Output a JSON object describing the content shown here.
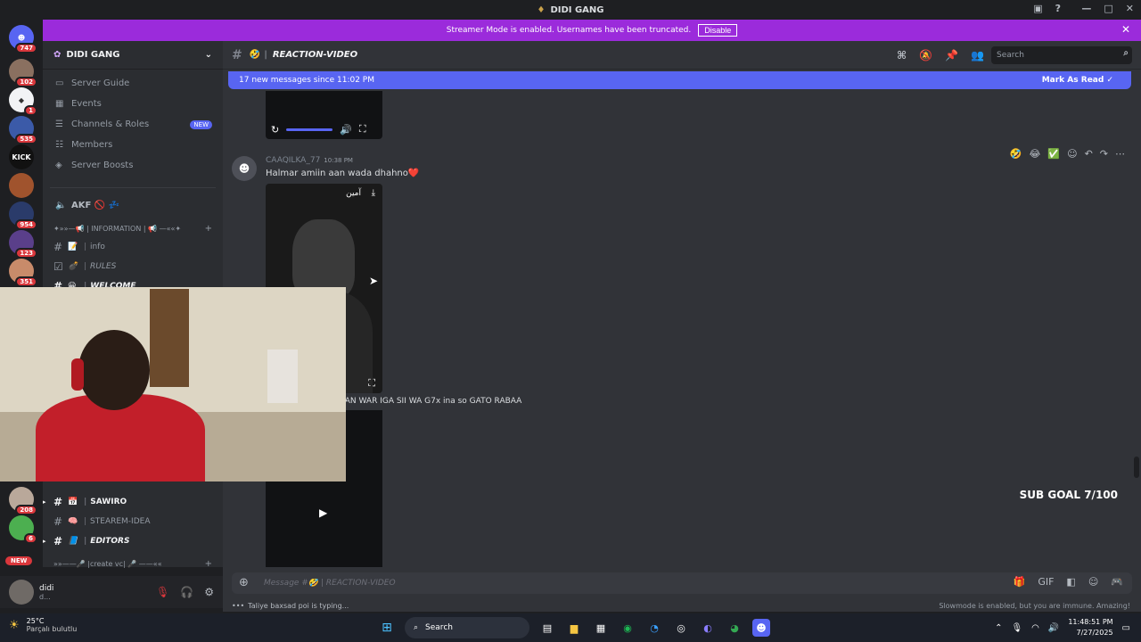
{
  "window": {
    "title": "DIDI GANG"
  },
  "banner": {
    "text": "Streamer Mode is enabled. Usernames have been truncated.",
    "disable_label": "Disable"
  },
  "server_rail": {
    "badges": [
      "747",
      "102",
      "1",
      "535",
      "954",
      "123",
      "351",
      "208",
      "6"
    ],
    "kick_label": "KICK",
    "new_label": "NEW"
  },
  "sidebar": {
    "server_name": "DIDI GANG",
    "nav": [
      {
        "label": "Server Guide",
        "icon": "book-icon"
      },
      {
        "label": "Events",
        "icon": "calendar-icon"
      },
      {
        "label": "Channels & Roles",
        "icon": "list-icon",
        "tag": "NEW"
      },
      {
        "label": "Members",
        "icon": "members-icon"
      },
      {
        "label": "Server Boosts",
        "icon": "boost-icon"
      }
    ],
    "voice_channel": "AKF 🚫 💤",
    "category_info": "✦»»—📢 | INFORMATION | 📢 —««✦",
    "channels": [
      {
        "emoji": "📝",
        "name": "info"
      },
      {
        "emoji": "💣",
        "name": "RULES"
      },
      {
        "emoji": "😀",
        "name": "WELCOME"
      }
    ],
    "channels_lower": [
      {
        "emoji": "📅",
        "name": "SAWIRO"
      },
      {
        "emoji": "🧠",
        "name": "STEAREM-IDEA"
      },
      {
        "emoji": "📘",
        "name": "EDITORS"
      }
    ],
    "category_vc": "»»——🎤 |create vc| 🎤 ——««"
  },
  "user": {
    "name": "didi",
    "status": "d..."
  },
  "header": {
    "channel_emoji": "🤣",
    "channel_name": "REACTION-VIDEO",
    "search_placeholder": "Search"
  },
  "chat": {
    "new_messages": "17 new messages since 11:02 PM",
    "mark_as_read": "Mark As Read",
    "message": {
      "author": "CAAQILKA_77",
      "time": "10:38 PM",
      "text": "Halmar amiin aan wada dhahno",
      "heart": "❤️",
      "video_overlay_text": "آمين"
    },
    "message2_text": "DAN WAR IGA SII WA G7x ina so GATO RABAA",
    "sub_goal": "SUB GOAL 7/100",
    "reactions": [
      "🤣",
      "😂",
      "✅"
    ]
  },
  "composer": {
    "placeholder": "Message #🤣 | REACTION-VIDEO"
  },
  "typing": {
    "text": "Taliye baxsad poi is typing...",
    "slowmode": "Slowmode is enabled, but you are immune. Amazing!"
  },
  "taskbar": {
    "weather_temp": "25°C",
    "weather_cond": "Parçalı bulutlu",
    "search_label": "Search",
    "time": "11:48:51 PM",
    "date": "7/27/2025"
  }
}
